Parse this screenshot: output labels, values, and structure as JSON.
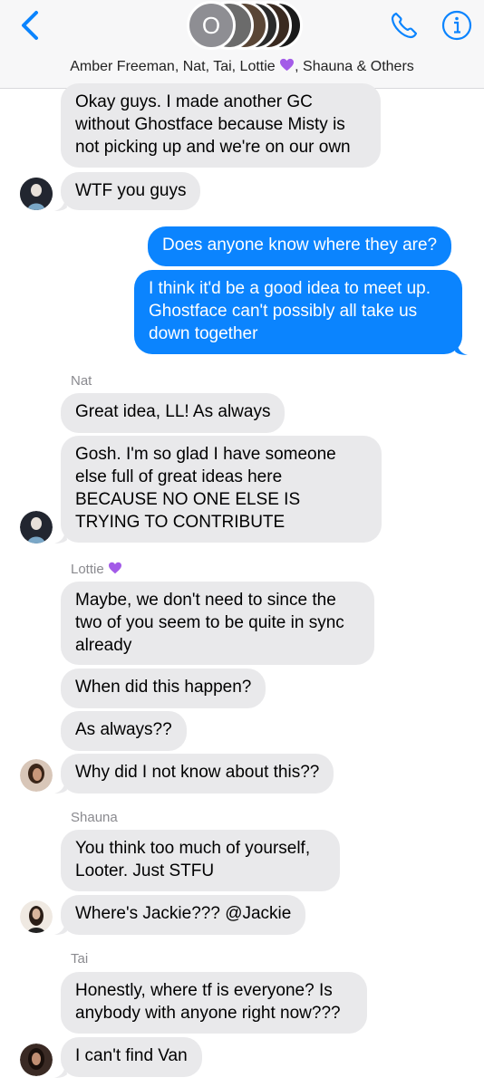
{
  "header": {
    "avatar_letter": "O",
    "names": "Amber Freeman, Nat, Tai, Lottie",
    "names_suffix": ", Shauna & Others",
    "back_icon": "chevron-left-icon",
    "phone_icon": "phone-icon",
    "info_icon": "info-icon",
    "accent_color": "#0b84fe"
  },
  "messages": [
    {
      "text": "Okay guys. I made another GC without Ghostface because Misty is not picking up and we're on our own"
    },
    {
      "text": "WTF you guys"
    },
    {
      "text": "Does anyone know where they are?"
    },
    {
      "text": "I think it'd be a good idea to meet up. Ghostface can't possibly all take us down together"
    },
    {
      "sender": "Nat"
    },
    {
      "text": "Great idea, LL! As always"
    },
    {
      "text": "Gosh. I'm so glad I have someone else full of great ideas here BECAUSE NO ONE ELSE IS TRYING TO CONTRIBUTE"
    },
    {
      "sender": "Lottie"
    },
    {
      "text": "Maybe, we don't need to since the two of you seem to be quite in sync already"
    },
    {
      "text": "When did this happen?"
    },
    {
      "text": "As always??"
    },
    {
      "text": "Why did I not know about this??"
    },
    {
      "sender": "Shauna"
    },
    {
      "text": "You think too much of yourself, Looter. Just STFU"
    },
    {
      "text": "Where's Jackie??? @Jackie"
    },
    {
      "sender": "Tai"
    },
    {
      "text": "Honestly, where tf is everyone? Is anybody with anyone right now???"
    },
    {
      "text": "I can't find Van"
    }
  ]
}
